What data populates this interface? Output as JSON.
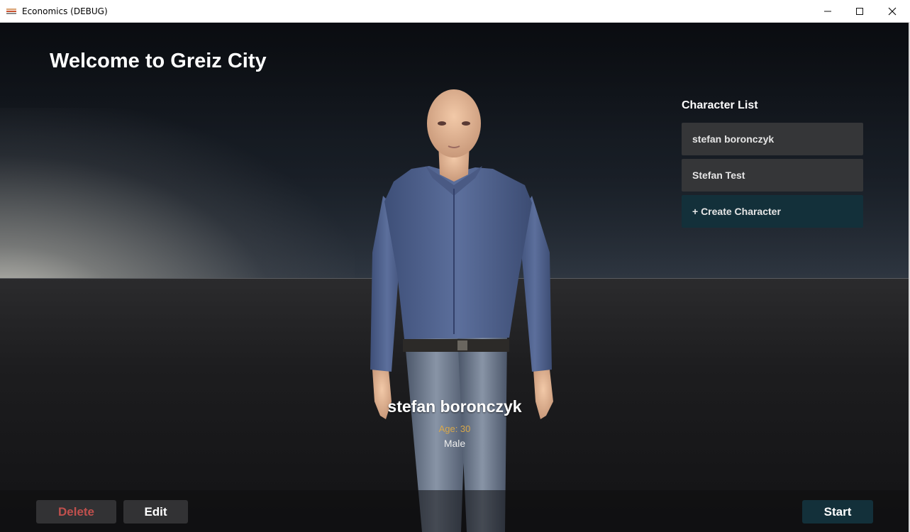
{
  "window": {
    "title": "Economics (DEBUG)",
    "icon": "app-icon",
    "controls": {
      "minimize": "minimize-icon",
      "maximize": "maximize-icon",
      "close": "close-icon"
    }
  },
  "header": {
    "title": "Welcome to Greiz City"
  },
  "character_list": {
    "title": "Character List",
    "items": [
      {
        "label": "stefan boronczyk"
      },
      {
        "label": "Stefan Test"
      }
    ],
    "create_label": "+ Create Character"
  },
  "selected_character": {
    "name": "stefan boronczyk",
    "age": "Age: 30",
    "gender": "Male"
  },
  "actions": {
    "delete_label": "Delete",
    "edit_label": "Edit",
    "start_label": "Start"
  },
  "colors": {
    "accent": "#13303a",
    "panel": "#353638",
    "danger": "#c0504d",
    "age": "#d8a84a"
  }
}
